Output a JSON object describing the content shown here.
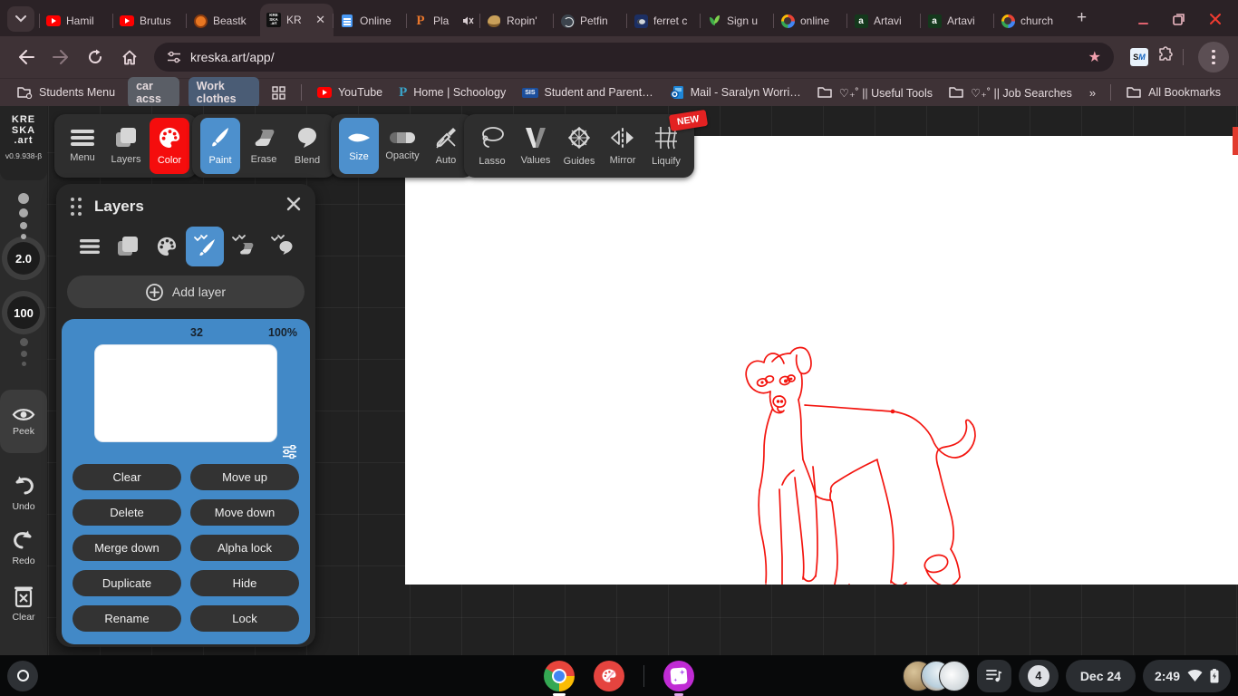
{
  "browser": {
    "tab_search_icon": "v",
    "tabs": [
      {
        "label": "Hamil",
        "icon": "youtube"
      },
      {
        "label": "Brutus",
        "icon": "youtube"
      },
      {
        "label": "Beastk",
        "icon": "beast"
      },
      {
        "label": "KR",
        "icon": "kreska",
        "active": true,
        "close": "✕"
      },
      {
        "label": "Online",
        "icon": "document"
      },
      {
        "label": "Pla",
        "icon": "planner",
        "muted": true
      },
      {
        "label": "Ropin'",
        "icon": "ropin"
      },
      {
        "label": "Petfin",
        "icon": "petfinder"
      },
      {
        "label": "ferret c",
        "icon": "ferret"
      },
      {
        "label": "Sign u",
        "icon": "sprout"
      },
      {
        "label": "online",
        "icon": "google"
      },
      {
        "label": "Artavi",
        "icon": "artavita"
      },
      {
        "label": "Artavi",
        "icon": "artavita"
      },
      {
        "label": "church",
        "icon": "google"
      }
    ],
    "address": {
      "url": "kreska.art/app/"
    },
    "extension_badge": {
      "s": "S",
      "m": "M"
    },
    "bookmarks": {
      "students_menu": "Students Menu",
      "pill1": "car acss",
      "pill2": "Work clothes",
      "youtube": "YouTube",
      "schoology": "Home | Schoology",
      "sis": "Student and Parent…",
      "sis_badge": "SIS",
      "mail": "Mail - Saralyn Worri…",
      "useful_tools": "♡₊˚ || Useful Tools",
      "job_searches": "♡₊˚ || Job Searches",
      "overflow": "»",
      "all_bookmarks": "All Bookmarks"
    }
  },
  "app": {
    "logo": {
      "line1": "KRE",
      "line2": "SKA",
      "line3": ".art",
      "version": "v0.9.938-β"
    },
    "toolbar": {
      "groups": [
        {
          "buttons": [
            {
              "label": "Menu"
            },
            {
              "label": "Layers"
            },
            {
              "label": "Color"
            }
          ]
        },
        {
          "buttons": [
            {
              "label": "Paint"
            },
            {
              "label": "Erase"
            },
            {
              "label": "Blend"
            }
          ]
        },
        {
          "buttons": [
            {
              "label": "Size"
            },
            {
              "label": "Opacity"
            },
            {
              "label": "Auto"
            }
          ]
        },
        {
          "buttons": [
            {
              "label": "Lasso"
            },
            {
              "label": "Values"
            },
            {
              "label": "Guides"
            },
            {
              "label": "Mirror"
            },
            {
              "label": "Liquify"
            }
          ],
          "badge": "NEW"
        }
      ],
      "accent_blue": "#4d90cd",
      "accent_red": "#f50d0d"
    },
    "sidebar": {
      "size_value": "2.0",
      "opacity_value": "100",
      "peek": "Peek",
      "undo": "Undo",
      "redo": "Redo",
      "clear": "Clear"
    },
    "layers_panel": {
      "title": "Layers",
      "add_layer": "Add layer",
      "layer": {
        "size": "32",
        "opacity": "100%",
        "card_color": "#4289c7"
      },
      "buttons": [
        "Clear",
        "Move up",
        "Delete",
        "Move down",
        "Merge down",
        "Alpha lock",
        "Duplicate",
        "Hide",
        "Rename",
        "Lock"
      ]
    },
    "canvas": {
      "stroke_color": "#f3150f"
    }
  },
  "shelf": {
    "notification_count": "4",
    "date": "Dec 24",
    "time": "2:49"
  }
}
